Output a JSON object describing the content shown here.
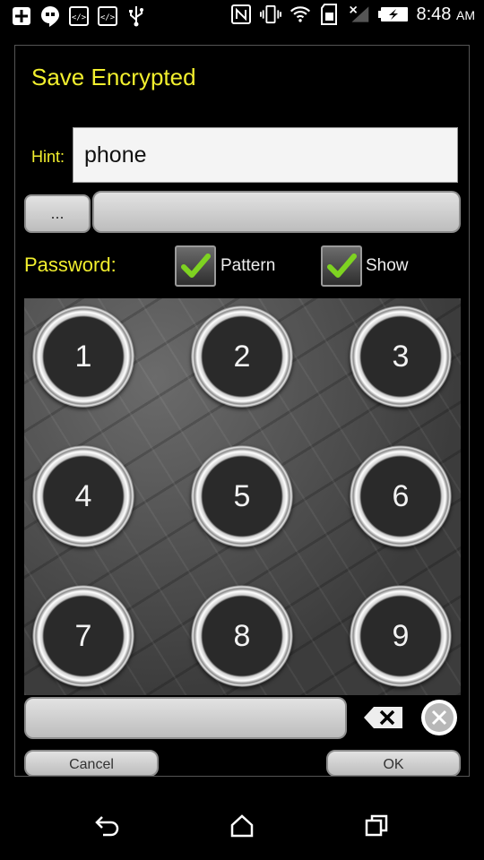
{
  "status_bar": {
    "time": "8:48",
    "ampm": "AM",
    "left_icons": [
      "add-box-icon",
      "hangouts-icon",
      "code-icon",
      "code-icon",
      "usb-icon"
    ],
    "right_icons": [
      "nfc-icon",
      "vibrate-icon",
      "wifi-icon",
      "sd-card-icon",
      "signal-off-icon",
      "battery-charging-icon"
    ]
  },
  "dialog": {
    "title": "Save Encrypted",
    "hint_label": "Hint:",
    "hint_value": "phone",
    "dots_button": "...",
    "password_label": "Password:",
    "pattern_label": "Pattern",
    "pattern_checked": true,
    "show_label": "Show",
    "show_checked": true,
    "keys": [
      "1",
      "2",
      "3",
      "4",
      "5",
      "6",
      "7",
      "8",
      "9"
    ],
    "cancel_label": "Cancel",
    "ok_label": "OK"
  },
  "nav_bar": {
    "icons": [
      "back-icon",
      "home-icon",
      "recents-icon"
    ]
  },
  "colors": {
    "accent_yellow": "#f2ef2e",
    "check_green": "#7ed321"
  }
}
